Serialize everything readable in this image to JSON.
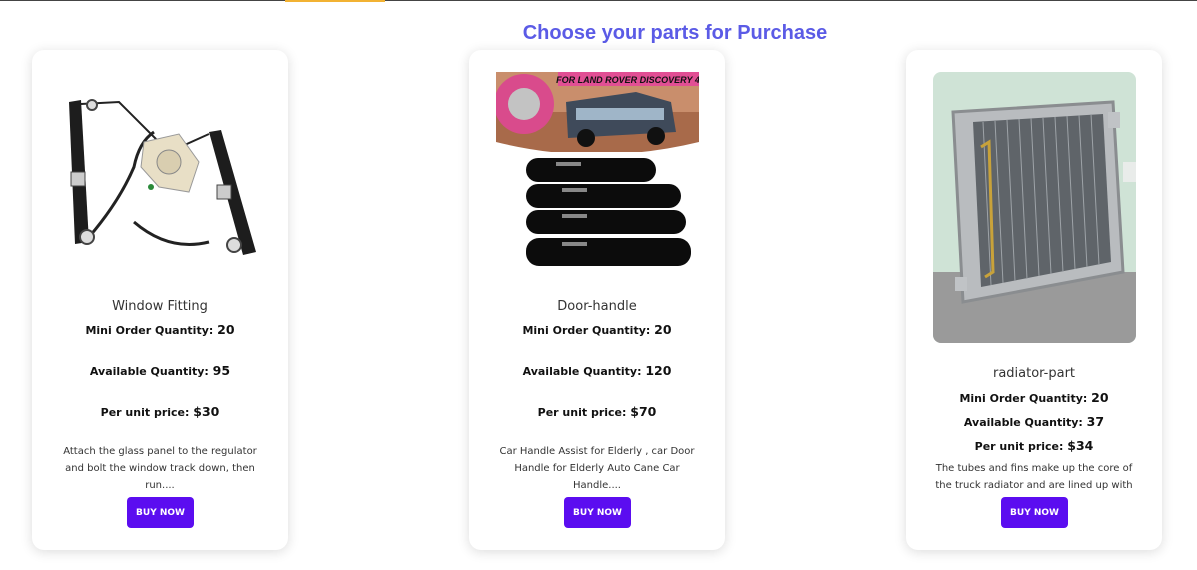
{
  "page": {
    "heading": "Choose your parts for Purchase"
  },
  "labels": {
    "min_order": "Mini Order Quantity:",
    "available": "Available Quantity:",
    "price": "Per unit price:"
  },
  "products": [
    {
      "name": "Window Fitting",
      "min_order": "20",
      "available": "95",
      "price": "$30",
      "description": "Attach the glass panel to the regulator and bolt the window track down, then run....",
      "button": "BUY NOW",
      "image_icon": "window-regulator-image"
    },
    {
      "name": "Door-handle",
      "min_order": "20",
      "available": "120",
      "price": "$70",
      "description": "Car Handle Assist for Elderly , car Door Handle for Elderly Auto Cane Car Handle....",
      "button": "BUY NOW",
      "image_icon": "door-handle-image",
      "image_banner": "FOR LAND ROVER DISCOVERY 4"
    },
    {
      "name": "radiator-part",
      "min_order": "20",
      "available": "37",
      "price": "$34",
      "description": "The tubes and fins make up the core of the truck radiator and are lined up with ....",
      "button": "BUY NOW",
      "image_icon": "radiator-image"
    }
  ],
  "colors": {
    "heading": "#5b5be6",
    "button": "#5b0df0"
  }
}
